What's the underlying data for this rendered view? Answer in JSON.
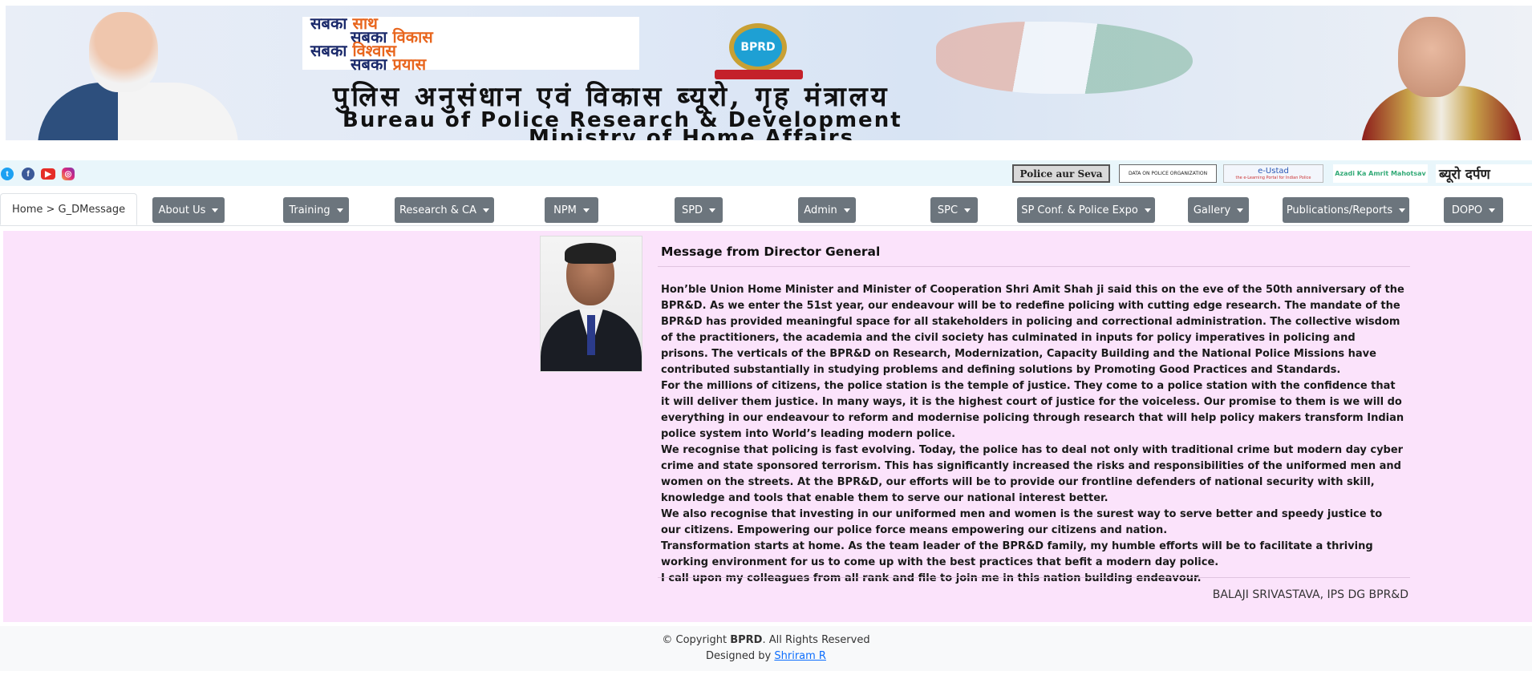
{
  "banner": {
    "slogan": [
      "सबका",
      "साथ",
      "सबका",
      "विकास",
      "सबका",
      "विश्वास",
      "सबका",
      "प्रयास"
    ],
    "emblem_text": "BPRD",
    "title_hindi": "पुलिस अनुसंधान एवं विकास ब्यूरो, गृह मंत्रालय",
    "title_english_1": "Bureau of Police Research & Development",
    "title_english_2": "Ministry of Home Affairs"
  },
  "social": {
    "icons": [
      "twitter-icon",
      "facebook-icon",
      "youtube-icon",
      "instagram-icon"
    ],
    "glyphs": {
      "twitter": "t",
      "facebook": "f",
      "youtube": "▶",
      "instagram": "◎"
    }
  },
  "partners": {
    "police_aur_seva": "Police aur Seva",
    "data_on_police": "DATA ON POLICE ORGANIZATION",
    "e_ustad": "e-Ustad",
    "e_ustad_sub": "the e-Learning Portal for Indian Police",
    "azadi": "Azadi Ka Amrit Mahotsav",
    "bureau_darpan": "ब्यूरो दर्पण"
  },
  "breadcrumb": "Home > G_DMessage",
  "nav": {
    "items": [
      "About Us",
      "Training",
      "Research & CA",
      "NPM",
      "SPD",
      "Admin",
      "SPC",
      "SP Conf. & Police Expo",
      "Gallery",
      "Publications/Reports",
      "DOPO"
    ]
  },
  "message": {
    "title": "Message from Director General",
    "paragraphs": [
      "Hon’ble Union Home Minister and Minister of Cooperation Shri Amit Shah ji said this on the eve of the 50th anniversary of the BPR&D. As we enter the 51st year, our endeavour will be to redefine policing with cutting edge research. The mandate of the BPR&D has provided meaningful space for all stakeholders in policing and correctional administration. The collective wisdom of the practitioners, the academia and the civil society has culminated in inputs for policy imperatives in policing and prisons. The verticals of the BPR&D on Research, Modernization, Capacity Building and the National Police Missions have contributed substantially in studying problems and defining solutions by Promoting Good Practices and Standards.",
      "For the millions of citizens, the police station is the temple of justice. They come to a police station with the confidence that it will deliver them justice. In many ways, it is the highest court of justice for the voiceless. Our promise to them is we will do everything in our endeavour to reform and modernise policing through research that will help policy makers transform Indian police system into World’s leading modern police.",
      "We recognise that policing is fast evolving. Today, the police has to deal not only with traditional crime but modern day cyber crime and state sponsored terrorism. This has significantly increased the risks and responsibilities of the uniformed men and women on the streets. At the BPR&D, our efforts will be to provide our frontline defenders of national security with skill, knowledge and tools that enable them to serve our national interest better.",
      "We also recognise that investing in our uniformed men and women is the surest way to serve better and speedy justice to our citizens. Empowering our police force means empowering our citizens and nation.",
      "Transformation starts at home. As the team leader of the BPR&D family, my humble efforts will be to facilitate a thriving working environment for us to come up with the best practices that befit a modern day police.",
      "I call upon my colleagues from all rank and file to join me in this nation building endeavour."
    ],
    "signature": "BALAJI SRIVASTAVA, IPS DG BPR&D"
  },
  "footer": {
    "copyright_prefix": "© Copyright ",
    "org": "BPRD",
    "copyright_suffix": ". All Rights Reserved",
    "designed_by": "Designed by ",
    "designer": "Shriram R"
  }
}
